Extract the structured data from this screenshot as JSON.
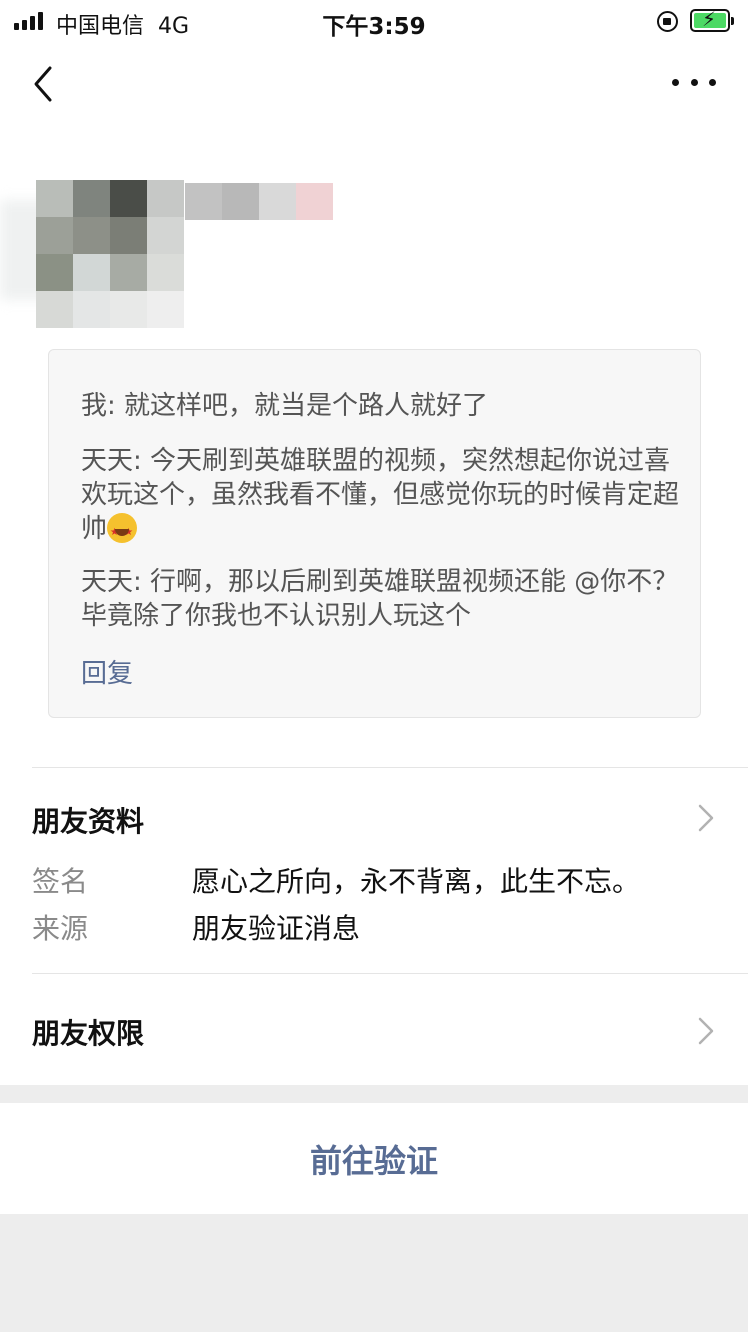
{
  "status_bar": {
    "carrier": "中国电信",
    "network": "4G",
    "time": "下午3:59"
  },
  "nav": {
    "back_icon": "chevron-left-icon",
    "more_icon": "more-dots-icon"
  },
  "messages": [
    {
      "text": "我: 就这样吧，就当是个路人就好了"
    },
    {
      "text": "天天: 今天刷到英雄联盟的视频，突然想起你说过喜欢玩这个，虽然我看不懂，但感觉你玩的时候肯定超帅",
      "emoji": "star-struck-emoji-icon"
    },
    {
      "text": "天天: 行啊，那以后刷到英雄联盟视频还能 @你不？毕竟除了你我也不认识别人玩这个"
    }
  ],
  "reply_label": "回复",
  "friend_info": {
    "title": "朋友资料",
    "signature_label": "签名",
    "signature_value": "愿心之所向，永不背离，此生不忘。",
    "source_label": "来源",
    "source_value": "朋友验证消息"
  },
  "permissions": {
    "title": "朋友权限"
  },
  "action": {
    "verify_label": "前往验证"
  },
  "colors": {
    "link": "#586c94",
    "message_text": "#555555",
    "card_bg": "#f7f7f7",
    "page_bg": "#ededed"
  }
}
